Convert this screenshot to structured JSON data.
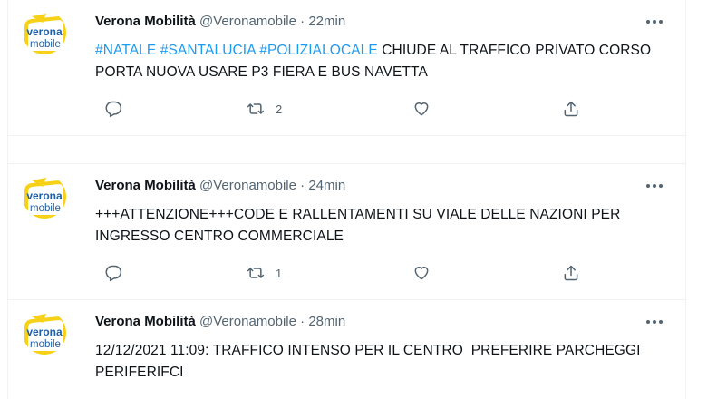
{
  "tweets": [
    {
      "name": "Verona Mobilità",
      "handle": "@Veronamobile",
      "separator": "·",
      "time": "22min",
      "hashtags": [
        "#NATALE",
        "#SANTALUCIA",
        "#POLIZIALOCALE"
      ],
      "text_after_tags": "CHIUDE AL TRAFFICO PRIVATO CORSO PORTA NUOVA USARE P3 FIERA E BUS NAVETTA",
      "retweets": "2",
      "replies": "",
      "likes": ""
    },
    {
      "name": "Verona Mobilità",
      "handle": "@Veronamobile",
      "separator": "·",
      "time": "24min",
      "text": "+++ATTENZIONE+++CODE E RALLENTAMENTI SU VIALE DELLE NAZIONI PER INGRESSO CENTRO COMMERCIALE",
      "retweets": "1",
      "replies": "",
      "likes": ""
    },
    {
      "name": "Verona Mobilità",
      "handle": "@Veronamobile",
      "separator": "·",
      "time": "28min",
      "text": "12/12/2021 11:09: TRAFFICO INTENSO PER IL CENTRO  PREFERIRE PARCHEGGI PERIFERIFCI"
    }
  ],
  "avatar": {
    "logo_top": "verona",
    "logo_bottom": "mobile"
  },
  "colors": {
    "accent": "#1d9bf0",
    "text": "#0f1419",
    "secondary": "#536471",
    "divider": "#eff3f4",
    "logo_yellow": "#f7d117",
    "logo_blue": "#1e5fa8"
  },
  "icons": [
    "reply-icon",
    "retweet-icon",
    "like-icon",
    "share-icon",
    "more-icon"
  ]
}
